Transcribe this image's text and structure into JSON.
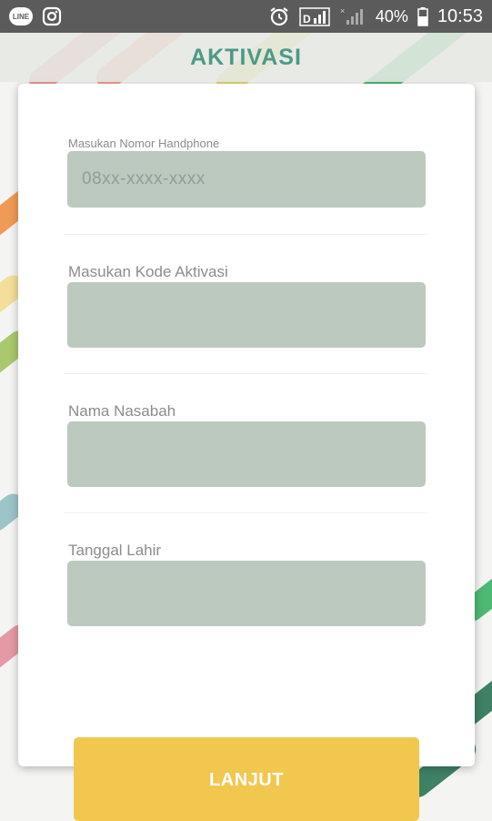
{
  "status_bar": {
    "line_icon_text": "LINE",
    "battery_percent": "40%",
    "time": "10:53"
  },
  "header": {
    "title": "AKTIVASI"
  },
  "form": {
    "phone": {
      "label": "Masukan Nomor Handphone",
      "placeholder": "08xx-xxxx-xxxx",
      "value": ""
    },
    "activation_code": {
      "label": "Masukan Kode Aktivasi",
      "value": ""
    },
    "customer_name": {
      "label": "Nama Nasabah",
      "value": ""
    },
    "birth_date": {
      "label": "Tanggal Lahir",
      "value": ""
    }
  },
  "submit": {
    "label": "LANJUT"
  },
  "colors": {
    "accent": "#4c9a86",
    "input_bg": "#bcc9bf",
    "button": "#f1c74e",
    "status_bar": "#5b5b5b"
  }
}
